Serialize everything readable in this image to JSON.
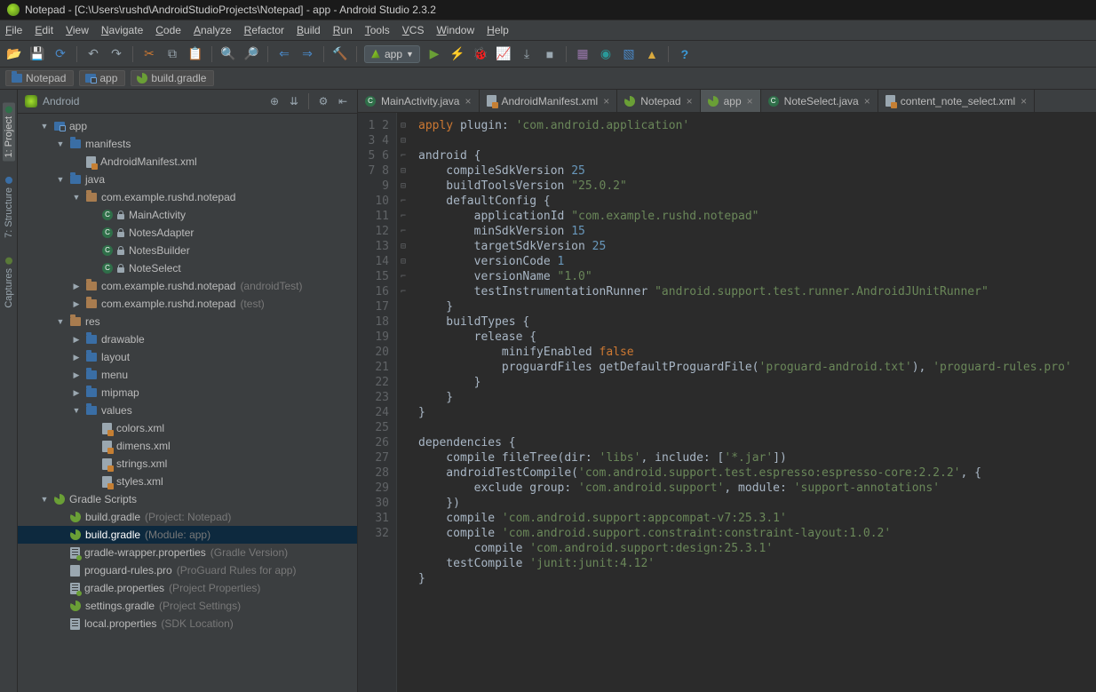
{
  "window_title": "Notepad - [C:\\Users\\rushd\\AndroidStudioProjects\\Notepad] - app - Android Studio 2.3.2",
  "menus": [
    "File",
    "Edit",
    "View",
    "Navigate",
    "Code",
    "Analyze",
    "Refactor",
    "Build",
    "Run",
    "Tools",
    "VCS",
    "Window",
    "Help"
  ],
  "run_config_label": "app",
  "breadcrumbs": [
    {
      "label": "Notepad",
      "icon": "folder"
    },
    {
      "label": "app",
      "icon": "module"
    },
    {
      "label": "build.gradle",
      "icon": "gradle"
    }
  ],
  "side_tabs": [
    {
      "label": "1: Project",
      "active": true
    },
    {
      "label": "7: Structure",
      "active": false
    },
    {
      "label": "Captures",
      "active": false
    }
  ],
  "sidebar_header": "Android",
  "project_tree": [
    {
      "d": 1,
      "chev": "down",
      "icon": "module",
      "label": "app"
    },
    {
      "d": 2,
      "chev": "down",
      "icon": "folder",
      "label": "manifests"
    },
    {
      "d": 3,
      "chev": "none",
      "icon": "xml",
      "label": "AndroidManifest.xml"
    },
    {
      "d": 2,
      "chev": "down",
      "icon": "folder",
      "label": "java"
    },
    {
      "d": 3,
      "chev": "down",
      "icon": "pkg",
      "label": "com.example.rushd.notepad"
    },
    {
      "d": 4,
      "chev": "none",
      "icon": "class",
      "lock": true,
      "label": "MainActivity"
    },
    {
      "d": 4,
      "chev": "none",
      "icon": "class",
      "lock": true,
      "label": "NotesAdapter"
    },
    {
      "d": 4,
      "chev": "none",
      "icon": "class",
      "lock": true,
      "label": "NotesBuilder"
    },
    {
      "d": 4,
      "chev": "none",
      "icon": "class",
      "lock": true,
      "label": "NoteSelect"
    },
    {
      "d": 3,
      "chev": "right",
      "icon": "pkg",
      "label": "com.example.rushd.notepad",
      "dim": "(androidTest)"
    },
    {
      "d": 3,
      "chev": "right",
      "icon": "pkg",
      "label": "com.example.rushd.notepad",
      "dim": "(test)"
    },
    {
      "d": 2,
      "chev": "down",
      "icon": "resfolder",
      "label": "res"
    },
    {
      "d": 3,
      "chev": "right",
      "icon": "folder",
      "label": "drawable"
    },
    {
      "d": 3,
      "chev": "right",
      "icon": "folder",
      "label": "layout"
    },
    {
      "d": 3,
      "chev": "right",
      "icon": "folder",
      "label": "menu"
    },
    {
      "d": 3,
      "chev": "right",
      "icon": "folder",
      "label": "mipmap"
    },
    {
      "d": 3,
      "chev": "down",
      "icon": "folder",
      "label": "values"
    },
    {
      "d": 4,
      "chev": "none",
      "icon": "xml",
      "label": "colors.xml"
    },
    {
      "d": 4,
      "chev": "none",
      "icon": "xml",
      "label": "dimens.xml"
    },
    {
      "d": 4,
      "chev": "none",
      "icon": "xml",
      "label": "strings.xml"
    },
    {
      "d": 4,
      "chev": "none",
      "icon": "xml",
      "label": "styles.xml"
    },
    {
      "d": 1,
      "chev": "down",
      "icon": "gradle",
      "label": "Gradle Scripts"
    },
    {
      "d": 2,
      "chev": "none",
      "icon": "gradle",
      "label": "build.gradle",
      "dim": "(Project: Notepad)"
    },
    {
      "d": 2,
      "chev": "none",
      "icon": "gradle",
      "label": "build.gradle",
      "dim": "(Module: app)",
      "sel": true
    },
    {
      "d": 2,
      "chev": "none",
      "icon": "gprop",
      "label": "gradle-wrapper.properties",
      "dim": "(Gradle Version)"
    },
    {
      "d": 2,
      "chev": "none",
      "icon": "text",
      "label": "proguard-rules.pro",
      "dim": "(ProGuard Rules for app)"
    },
    {
      "d": 2,
      "chev": "none",
      "icon": "gprop",
      "label": "gradle.properties",
      "dim": "(Project Properties)"
    },
    {
      "d": 2,
      "chev": "none",
      "icon": "gradle",
      "label": "settings.gradle",
      "dim": "(Project Settings)"
    },
    {
      "d": 2,
      "chev": "none",
      "icon": "prop",
      "label": "local.properties",
      "dim": "(SDK Location)"
    }
  ],
  "editor_tabs": [
    {
      "label": "MainActivity.java",
      "icon": "class",
      "active": false
    },
    {
      "label": "AndroidManifest.xml",
      "icon": "xml",
      "active": false
    },
    {
      "label": "Notepad",
      "icon": "gradle",
      "active": false
    },
    {
      "label": "app",
      "icon": "gradle",
      "active": true
    },
    {
      "label": "NoteSelect.java",
      "icon": "class",
      "active": false
    },
    {
      "label": "content_note_select.xml",
      "icon": "xml",
      "active": false
    }
  ],
  "line_count": 32,
  "code_lines": [
    [
      [
        "k",
        "apply"
      ],
      [
        "p",
        " plugin: "
      ],
      [
        "s",
        "'com.android.application'"
      ]
    ],
    [],
    [
      [
        "p",
        "android {"
      ]
    ],
    [
      [
        "p",
        "    compileSdkVersion "
      ],
      [
        "n",
        "25"
      ]
    ],
    [
      [
        "p",
        "    buildToolsVersion "
      ],
      [
        "s",
        "\"25.0.2\""
      ]
    ],
    [
      [
        "p",
        "    defaultConfig {"
      ]
    ],
    [
      [
        "p",
        "        applicationId "
      ],
      [
        "s",
        "\"com.example.rushd.notepad\""
      ]
    ],
    [
      [
        "p",
        "        minSdkVersion "
      ],
      [
        "n",
        "15"
      ]
    ],
    [
      [
        "p",
        "        targetSdkVersion "
      ],
      [
        "n",
        "25"
      ]
    ],
    [
      [
        "p",
        "        versionCode "
      ],
      [
        "n",
        "1"
      ]
    ],
    [
      [
        "p",
        "        versionName "
      ],
      [
        "s",
        "\"1.0\""
      ]
    ],
    [
      [
        "p",
        "        testInstrumentationRunner "
      ],
      [
        "s",
        "\"android.support.test.runner.AndroidJUnitRunner\""
      ]
    ],
    [
      [
        "p",
        "    }"
      ]
    ],
    [
      [
        "p",
        "    buildTypes {"
      ]
    ],
    [
      [
        "p",
        "        release {"
      ]
    ],
    [
      [
        "p",
        "            minifyEnabled "
      ],
      [
        "k",
        "false"
      ]
    ],
    [
      [
        "p",
        "            proguardFiles getDefaultProguardFile("
      ],
      [
        "s",
        "'proguard-android.txt'"
      ],
      [
        "p",
        "), "
      ],
      [
        "s",
        "'proguard-rules.pro'"
      ]
    ],
    [
      [
        "p",
        "        }"
      ]
    ],
    [
      [
        "p",
        "    }"
      ]
    ],
    [
      [
        "p",
        "}"
      ]
    ],
    [],
    [
      [
        "p",
        "dependencies {"
      ]
    ],
    [
      [
        "p",
        "    compile fileTree(dir: "
      ],
      [
        "s",
        "'libs'"
      ],
      [
        "p",
        ", include: ["
      ],
      [
        "s",
        "'*.jar'"
      ],
      [
        "p",
        "])"
      ]
    ],
    [
      [
        "p",
        "    androidTestCompile("
      ],
      [
        "s",
        "'com.android.support.test.espresso:espresso-core:2.2.2'"
      ],
      [
        "p",
        ", {"
      ]
    ],
    [
      [
        "p",
        "        exclude group: "
      ],
      [
        "s",
        "'com.android.support'"
      ],
      [
        "p",
        ", module: "
      ],
      [
        "s",
        "'support-annotations'"
      ]
    ],
    [
      [
        "p",
        "    })"
      ]
    ],
    [
      [
        "p",
        "    compile "
      ],
      [
        "s",
        "'com.android.support:appcompat-v7:25.3.1'"
      ]
    ],
    [
      [
        "p",
        "    compile "
      ],
      [
        "s",
        "'com.android.support.constraint:constraint-layout:1.0.2'"
      ]
    ],
    [
      [
        "p",
        "        compile "
      ],
      [
        "s",
        "'com.android.support:design:25.3.1'"
      ]
    ],
    [
      [
        "p",
        "    testCompile "
      ],
      [
        "s",
        "'junit:junit:4.12'"
      ]
    ],
    [
      [
        "p",
        "}"
      ]
    ],
    []
  ]
}
